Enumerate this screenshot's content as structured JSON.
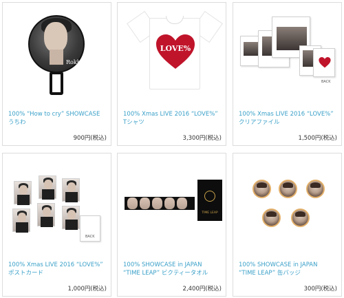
{
  "products": [
    {
      "title": "100% “How to cry” SHOWCASE\nうちわ",
      "price": "900円(税込)"
    },
    {
      "title": "100% Xmas LIVE 2016 “LOVE%”\nTシャツ",
      "price": "3,300円(税込)"
    },
    {
      "title": "100% Xmas LIVE 2016 “LOVE%”\nクリアファイル",
      "price": "1,500円(税込)"
    },
    {
      "title": "100% Xmas LIVE 2016 “LOVE%”\nポストカード",
      "price": "1,000円(税込)"
    },
    {
      "title": "100% SHOWCASE in JAPAN\n“TIME LEAP” ビクティータオル",
      "price": "2,400円(税込)"
    },
    {
      "title": "100% SHOWCASE in JAPAN\n“TIME LEAP” 缶バッジ",
      "price": "300円(税込)"
    }
  ],
  "images": {
    "fan_name": "Rokhyun",
    "shirt_text": "LOVE%",
    "back_label": "BACK",
    "towel_text": "TIME LEAP"
  },
  "colors": {
    "title": "#3aa0c8",
    "price": "#333333",
    "border": "#dcdcdc",
    "heart": "#c0142b"
  }
}
